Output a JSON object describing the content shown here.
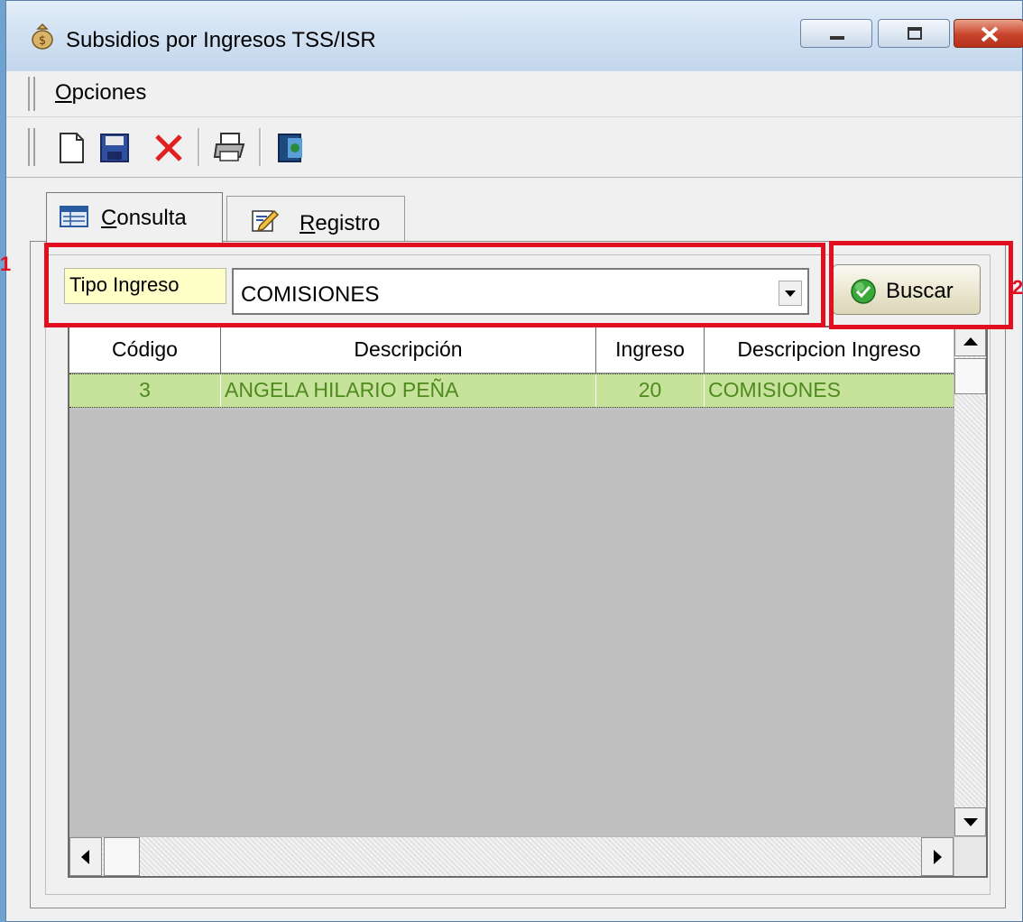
{
  "window": {
    "title": "Subsidios por Ingresos TSS/ISR",
    "app_icon": "money-bag-icon"
  },
  "menu": {
    "items": [
      {
        "accel": "O",
        "rest": "pciones"
      }
    ]
  },
  "toolbar": {
    "tools": [
      "new-document-icon",
      "save-icon",
      "delete-icon",
      "print-icon",
      "exit-icon"
    ]
  },
  "tabs": [
    {
      "accel": "C",
      "rest": "onsulta",
      "icon": "query-table-icon",
      "active": true
    },
    {
      "accel": "R",
      "rest": "egistro",
      "icon": "edit-pencil-icon",
      "active": false
    }
  ],
  "filter": {
    "label": "Tipo Ingreso",
    "value": "COMISIONES"
  },
  "search_button": {
    "label": "Buscar"
  },
  "annotations": [
    "1",
    "2"
  ],
  "grid": {
    "columns": [
      "Código",
      "Descripción",
      "Ingreso",
      "Descripcion Ingreso"
    ],
    "rows": [
      [
        "3",
        "ANGELA HILARIO PEÑA",
        "20",
        "COMISIONES"
      ]
    ]
  },
  "colors": {
    "annotation": "#e01020",
    "selected_row": "#c7e29b",
    "selected_text": "#4f8a1f",
    "label_bg": "#ffffc8"
  }
}
